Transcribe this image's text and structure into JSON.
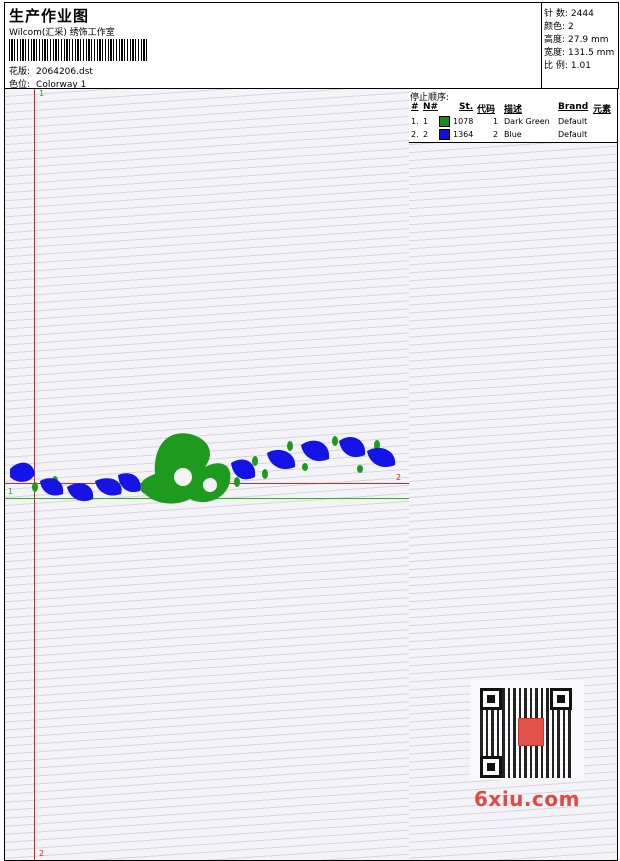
{
  "header": {
    "title": "生产作业图",
    "subtitle": "Wilcom(汇采) 绣饰工作室",
    "design_label": "花版:",
    "design_value": "2064206.dst",
    "color_label": "色位:",
    "color_value": "Colorway 1"
  },
  "stats": [
    {
      "label": "针 数:",
      "value": "2444"
    },
    {
      "label": "颜色:",
      "value": "2"
    },
    {
      "label": "高度:",
      "value": "27.9 mm"
    },
    {
      "label": "宽度:",
      "value": "131.5 mm"
    },
    {
      "label": "比 例:",
      "value": "1.01"
    }
  ],
  "stop_sequence": {
    "title": "停止顺序:",
    "columns": [
      "#",
      "N#",
      "St.",
      "代码",
      "描述",
      "Brand",
      "元素"
    ],
    "rows": [
      {
        "index": "1.",
        "n": "1",
        "color": "#1a8a1a",
        "stitches": "1078",
        "code": "1",
        "desc": "Dark Green",
        "brand": "Default"
      },
      {
        "index": "2.",
        "n": "2",
        "color": "#1010e0",
        "stitches": "1364",
        "code": "2",
        "desc": "Blue",
        "brand": "Default"
      }
    ]
  },
  "canvas": {
    "marks": {
      "top_v": "1",
      "bottom_v": "2",
      "left_h": "1",
      "right_h": "2"
    }
  },
  "watermark": {
    "text": "6xiu.com"
  }
}
